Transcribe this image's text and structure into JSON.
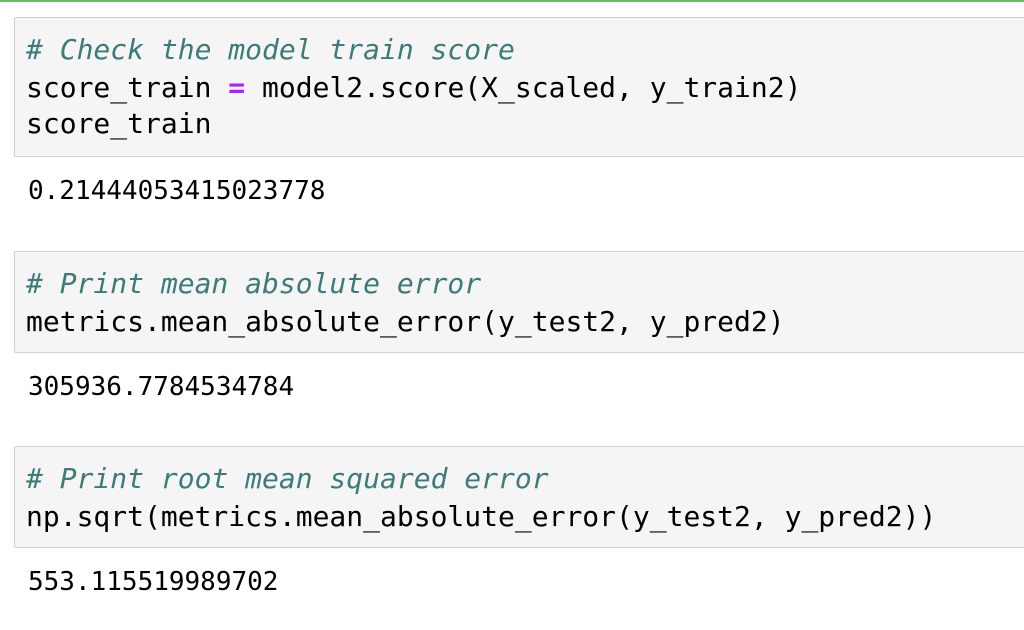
{
  "cells": [
    {
      "comment": "# Check the model train score",
      "code_line_2": {
        "lhs": "score_train ",
        "op": "=",
        "rhs": " model2.score(X_scaled, y_train2)"
      },
      "code_line_3": "score_train",
      "output": "0.21444053415023778"
    },
    {
      "comment": "# Print mean absolute error",
      "code_line_2": "metrics.mean_absolute_error(y_test2, y_pred2)",
      "output": "305936.7784534784"
    },
    {
      "comment": "# Print root mean squared error",
      "code_line_2": "np.sqrt(metrics.mean_absolute_error(y_test2, y_pred2))",
      "output": "553.115519989702"
    }
  ],
  "colors": {
    "comment": "#3d7b7b",
    "operator": "#aa22ff",
    "input_background": "#f5f5f5",
    "selected_cell_border": "#66bb6a"
  }
}
